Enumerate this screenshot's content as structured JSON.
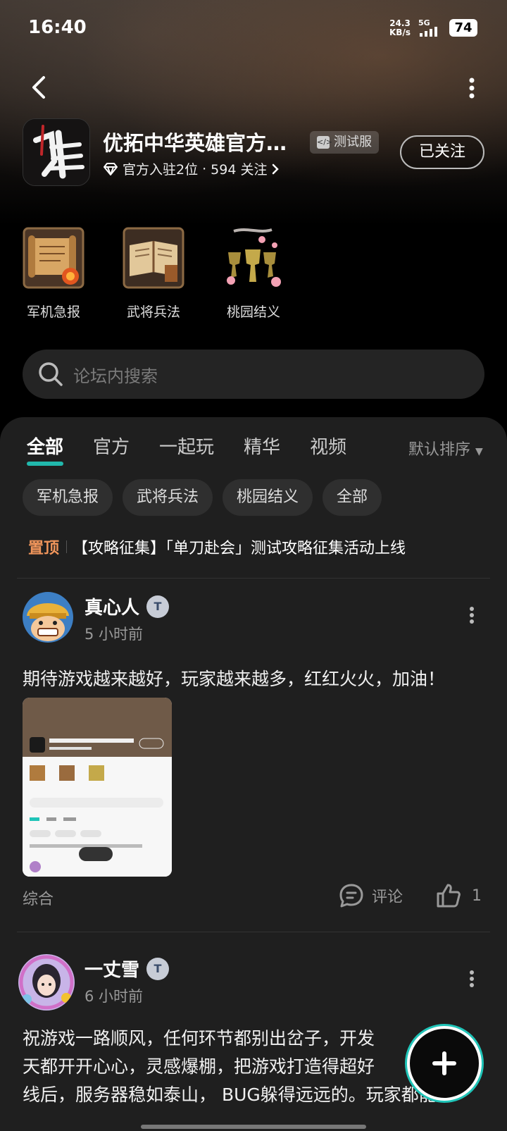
{
  "status_bar": {
    "time": "16:40",
    "net_speed": "24.3",
    "net_unit": "KB/s",
    "network": "5G",
    "battery": "74"
  },
  "header": {
    "game_name": "优拓中华英雄官方…",
    "server_badge": "测试服",
    "official_rank": "官方入驻2位",
    "followers": "594 关注",
    "follow_button": "已关注"
  },
  "shortcuts": [
    {
      "label": "军机急报",
      "icon": "scroll-icon"
    },
    {
      "label": "武将兵法",
      "icon": "book-icon"
    },
    {
      "label": "桃园结义",
      "icon": "goblets-icon"
    }
  ],
  "search": {
    "placeholder": "论坛内搜索"
  },
  "tabs": [
    {
      "label": "全部",
      "active": true
    },
    {
      "label": "官方",
      "active": false
    },
    {
      "label": "一起玩",
      "active": false
    },
    {
      "label": "精华",
      "active": false
    },
    {
      "label": "视频",
      "active": false
    }
  ],
  "sort": {
    "label": "默认排序"
  },
  "chips": [
    "军机急报",
    "武将兵法",
    "桃园结义",
    "全部"
  ],
  "pinned": {
    "tag": "置顶",
    "title": "【攻略征集】「单刀赴会」测试攻略征集活动上线"
  },
  "posts": [
    {
      "author": "真心人",
      "badge": "T",
      "time": "5 小时前",
      "content": "期待游戏越来越好，玩家越来越多，红红火火，加油！",
      "category": "综合",
      "comment_label": "评论",
      "likes": "1"
    },
    {
      "author": "一丈雪",
      "badge": "T",
      "time": "6 小时前",
      "content_lines": [
        "祝游戏一路顺风，任何环节都别出岔子，开发",
        "天都开开心心，灵感爆棚，把游戏打造得超好",
        "线后，服务器稳如泰山， BUG躲得远远的。玩家都能"
      ]
    }
  ],
  "colors": {
    "accent": "#22d3c5",
    "pinned_tag": "#f0955b",
    "panel_bg": "#1f1f1f"
  }
}
